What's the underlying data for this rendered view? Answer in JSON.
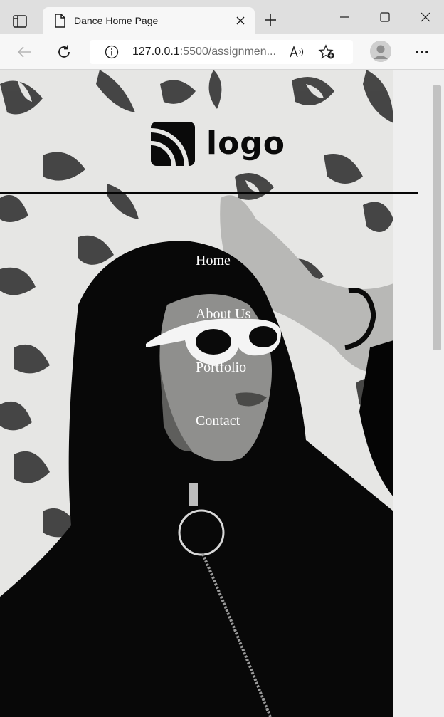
{
  "browser": {
    "tab_title": "Dance Home Page",
    "url_host": "127.0.0.1",
    "url_rest": ":5500/assignmen...",
    "icons": {
      "tab_actions": "tab-actions-icon",
      "page": "page-icon",
      "close": "close-icon",
      "new_tab": "plus-icon",
      "minimize": "minimize-icon",
      "maximize": "maximize-icon",
      "window_close": "window-close-icon",
      "back": "back-arrow-icon",
      "refresh": "refresh-icon",
      "info": "info-icon",
      "read_aloud": "read-aloud-icon",
      "favorites": "favorite-add-icon",
      "profile": "profile-icon",
      "more": "more-icon"
    }
  },
  "site": {
    "logo_text": "logo",
    "nav": [
      {
        "label": "Home"
      },
      {
        "label": "About Us"
      },
      {
        "label": "Portfolio"
      },
      {
        "label": "Contact"
      }
    ]
  },
  "colors": {
    "nav_text": "#ffffff",
    "divider": "#050505",
    "chrome_bg": "#dfdfdf"
  }
}
